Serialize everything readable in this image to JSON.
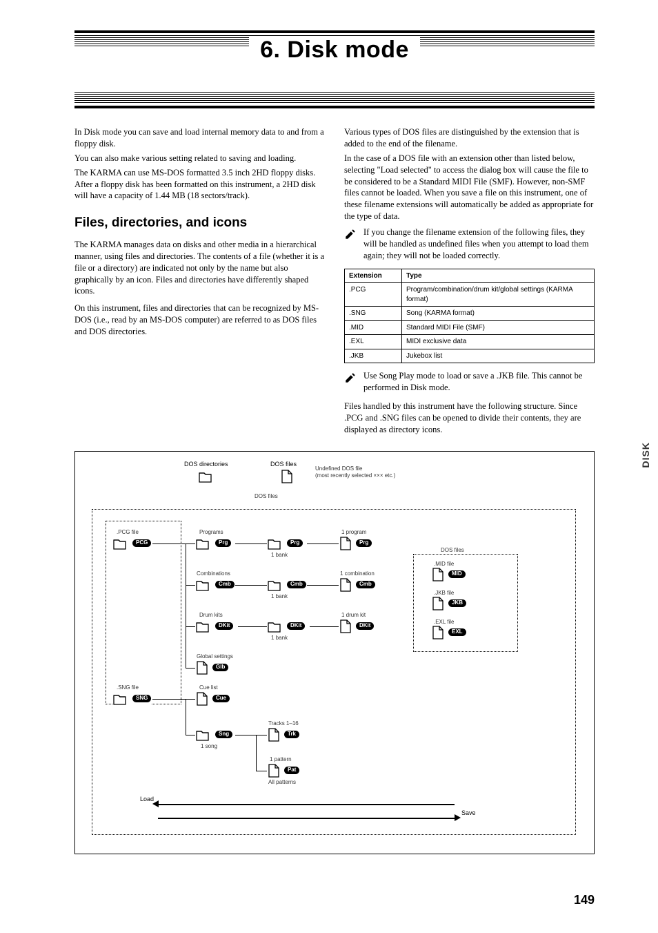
{
  "chapter": {
    "title": "6. Disk mode"
  },
  "intro": {
    "p1": "In Disk mode you can save and load internal memory data to and from a floppy disk.",
    "p2": "You can also make various setting related to saving and loading.",
    "p3": "The KARMA can use MS-DOS formatted 3.5 inch 2HD floppy disks. After a floppy disk has been formatted on this instrument, a 2HD disk will have a capacity of 1.44 MB (18 sectors/track)."
  },
  "section1": {
    "heading": "Files, directories, and icons",
    "p1": "The KARMA manages data on disks and other media in a hierarchical manner, using files and directories. The contents of a file (whether it is a file or a directory) are indicated not only by the name but also graphically by an icon. Files and directories have differently shaped icons.",
    "p2": "On this instrument, files and directories that can be recognized by MS-DOS (i.e., read by an MS-DOS computer) are referred to as DOS files and DOS directories."
  },
  "right": {
    "p1": "Various types of DOS files are distinguished by the extension that is added to the end of the filename.",
    "p2": "In the case of a DOS file with an extension other than listed below, selecting \"Load selected\" to access the dialog box will cause the file to be considered to be a Standard MIDI File (SMF). However, non-SMF files cannot be loaded. When you save a file on this instrument, one of these filename extensions will automatically be added as appropriate for the type of data.",
    "note1": "If you change the filename extension of the following files, they will be handled as undefined files when you attempt to load them again; they will not be loaded correctly.",
    "note2": "Use Song Play mode to load or save a .JKB file. This cannot be performed in Disk mode.",
    "p3": "Files handled by this instrument have the following structure. Since .PCG and .SNG files can be opened to divide their contents, they are displayed as directory icons."
  },
  "ext_table": {
    "headers": [
      "Extension",
      "Type"
    ],
    "rows": [
      [
        ".PCG",
        "Program/combination/drum kit/global settings (KARMA format)"
      ],
      [
        ".SNG",
        "Song (KARMA format)"
      ],
      [
        ".MID",
        "Standard MIDI File (SMF)"
      ],
      [
        ".EXL",
        "MIDI exclusive data"
      ],
      [
        ".JKB",
        "Jukebox list"
      ]
    ]
  },
  "diagram": {
    "header_dir_label": "DOS directories",
    "header_file_label": "DOS files",
    "header_undef_label": "Undefined DOS file",
    "header_most_label": "(most recently selected ××× etc.)",
    "dos_files_hint": "DOS files",
    "pcg": {
      "root": ".PCG file",
      "programs": "Programs",
      "bank": "1 bank",
      "oneprogram": "1 program",
      "combis": "Combinations",
      "onecombi": "1 combination",
      "drumkits": "Drum kits",
      "onedrumkit": "1 drum kit",
      "global": "Global settings"
    },
    "sng": {
      "root": ".SNG file",
      "cuelist": "Cue list",
      "onesong": "1 song",
      "tracks": "Tracks 1–16",
      "pattern": "1 pattern",
      "allpatterns": "All patterns"
    },
    "box": {
      "mid": ".MID file",
      "jkb": ".JKB file",
      "exl": ".EXL file",
      "hint": "DOS files"
    },
    "badges": {
      "pcg": "PCG",
      "prg": "Prg",
      "cmb": "Cmb",
      "dkit": "DKit",
      "glb": "Glb",
      "sng": "SNG",
      "cue": "Cue",
      "sng1": "Sng",
      "trk": "Trk",
      "pat": "Pat",
      "mid": "MID",
      "jkb": "JKB",
      "exl": "EXL"
    },
    "axis": {
      "load": "Load",
      "save": "Save"
    }
  },
  "side_tab": "DISK",
  "page_number": "149"
}
